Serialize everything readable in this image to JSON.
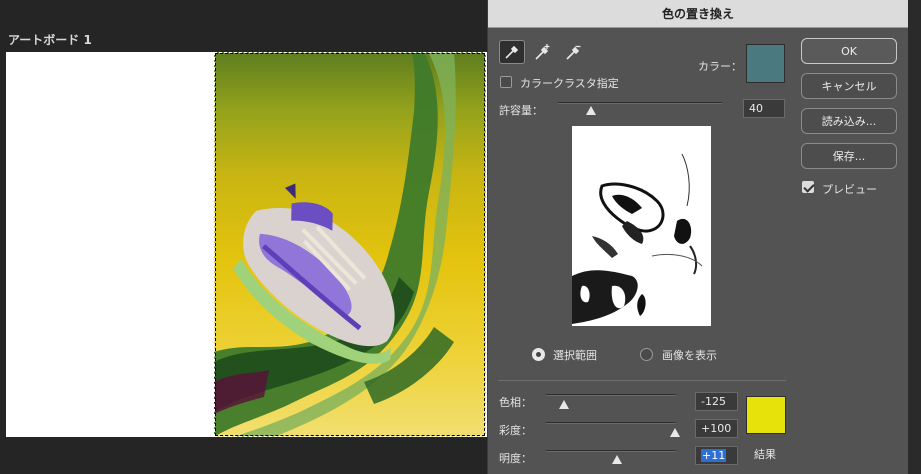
{
  "canvas": {
    "artboard_label": "アートボード 1"
  },
  "dialog": {
    "title": "色の置き換え",
    "tools": [
      "eyedropper-icon",
      "eyedropper-plus-icon",
      "eyedropper-minus-icon"
    ],
    "localized_color_clusters_label": "カラークラスタ指定",
    "color_label": "カラー：",
    "color_value": "#4a7a80",
    "fuzziness_label": "許容量：",
    "fuzziness_value": "40",
    "fuzziness_level": 0.2,
    "view_options": {
      "selection_label": "選択範囲",
      "image_label": "画像を表示",
      "selected": "selection"
    },
    "hue_label": "色相：",
    "hue_value": "-125",
    "saturation_label": "彩度：",
    "saturation_value": "+100",
    "lightness_label": "明度：",
    "lightness_value": "+11",
    "result_label": "結果",
    "result_color": "#e6e20a",
    "buttons": {
      "ok": "OK",
      "cancel": "キャンセル",
      "load": "読み込み...",
      "save": "保存..."
    },
    "preview_label": "プレビュー",
    "preview_checked": true
  }
}
